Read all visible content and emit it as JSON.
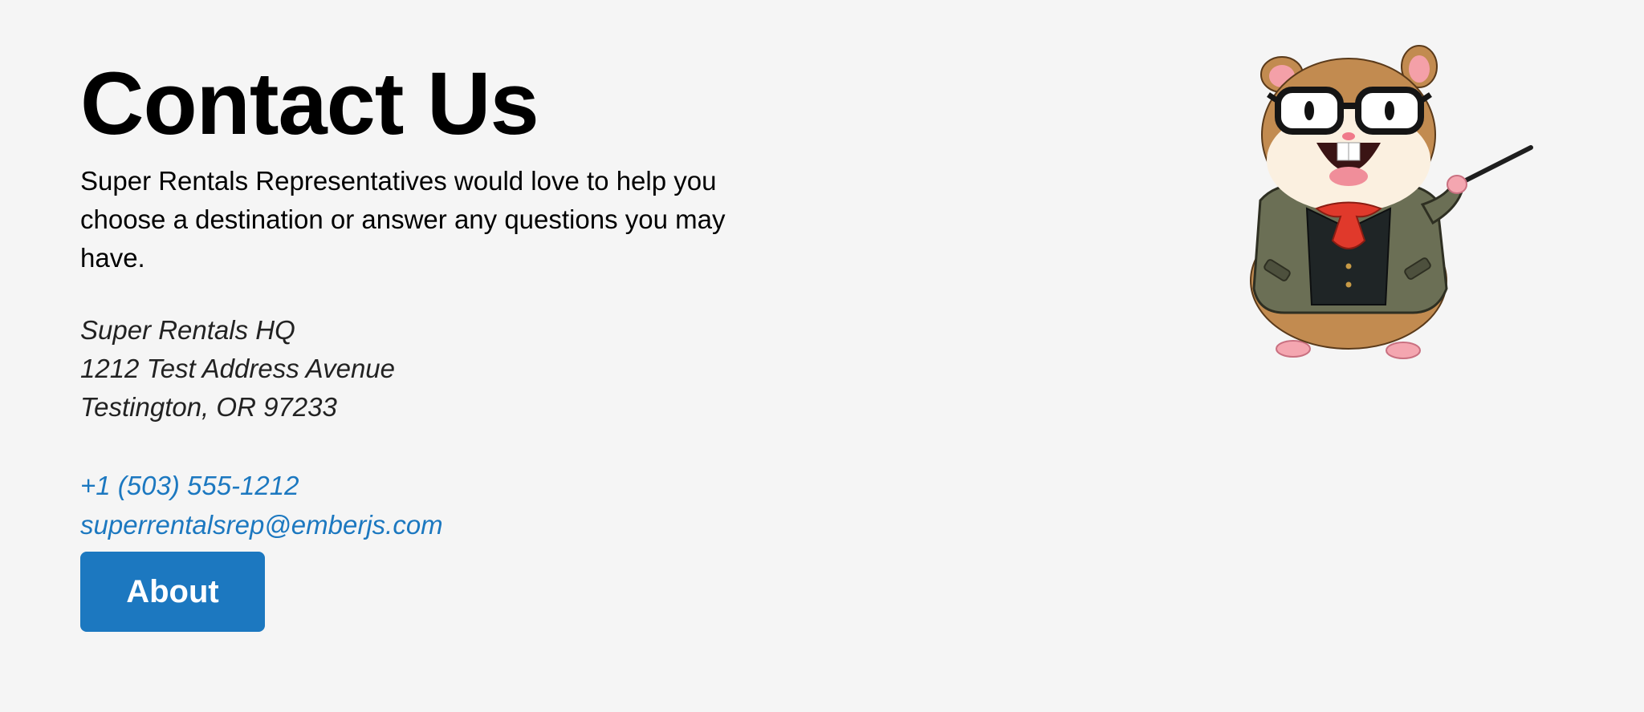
{
  "page": {
    "title": "Contact Us",
    "intro": "Super Rentals Representatives would love to help you choose a destination or answer any questions you may have."
  },
  "address": {
    "lines": [
      "Super Rentals HQ",
      "1212 Test Address Avenue",
      "Testington, OR 97233"
    ]
  },
  "contact": {
    "phone": "+1 (503) 555-1212",
    "email": "superrentalsrep@emberjs.com"
  },
  "nav": {
    "about_label": "About"
  },
  "colors": {
    "accent": "#1c78c0",
    "background": "#f5f5f5"
  },
  "images": {
    "mascot": "tomster-teacher-mascot"
  }
}
